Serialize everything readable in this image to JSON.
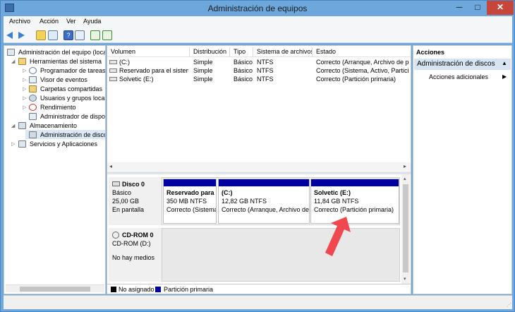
{
  "window": {
    "title": "Administración de equipos",
    "minimize": "─",
    "maximize": "□",
    "close": "✕"
  },
  "menu": [
    "Archivo",
    "Acción",
    "Ver",
    "Ayuda"
  ],
  "tree": {
    "root": "Administración del equipo (local)",
    "tools": "Herramientas del sistema",
    "tools_items": [
      "Programador de tareas",
      "Visor de eventos",
      "Carpetas compartidas",
      "Usuarios y grupos locales",
      "Rendimiento",
      "Administrador de dispositivos"
    ],
    "storage": "Almacenamiento",
    "storage_items": [
      "Administración de discos"
    ],
    "services": "Servicios y Aplicaciones"
  },
  "volumes": {
    "headers": [
      "Volumen",
      "Distribución",
      "Tipo",
      "Sistema de archivos",
      "Estado"
    ],
    "rows": [
      {
        "vol": "(C:)",
        "dist": "Simple",
        "type": "Básico",
        "fs": "NTFS",
        "state": "Correcto (Arranque, Archivo de paginación, Volcado, Partición primaria)"
      },
      {
        "vol": "Reservado para el sistema",
        "dist": "Simple",
        "type": "Básico",
        "fs": "NTFS",
        "state": "Correcto (Sistema, Activo, Partición primaria)"
      },
      {
        "vol": "Solvetic (E:)",
        "dist": "Simple",
        "type": "Básico",
        "fs": "NTFS",
        "state": "Correcto (Partición primaria)"
      }
    ]
  },
  "disk0": {
    "name": "Disco 0",
    "kind": "Básico",
    "size": "25,00 GB",
    "status": "En pantalla",
    "partitions": [
      {
        "name": "Reservado para el sistema",
        "size": "350 MB NTFS",
        "state": "Correcto (Sistema, Activo, Partición primaria)"
      },
      {
        "name": "(C:)",
        "size": "12,82 GB NTFS",
        "state": "Correcto (Arranque, Archivo de paginación, Volcado, Partición primaria)"
      },
      {
        "name": "Solvetic  (E:)",
        "size": "11,84 GB NTFS",
        "state": "Correcto (Partición primaria)"
      }
    ]
  },
  "cdrom": {
    "name": "CD-ROM 0",
    "drive": "CD-ROM (D:)",
    "status": "No hay medios"
  },
  "legend": {
    "unallocated": "No asignado",
    "primary": "Partición primaria"
  },
  "actions": {
    "title": "Acciones",
    "section": "Administración de discos",
    "more": "Acciones adicionales"
  },
  "colors": {
    "primary_partition": "#00009e",
    "unallocated": "#000000",
    "arrow": "#f0484e",
    "title_bar": "#6ea7dc"
  }
}
